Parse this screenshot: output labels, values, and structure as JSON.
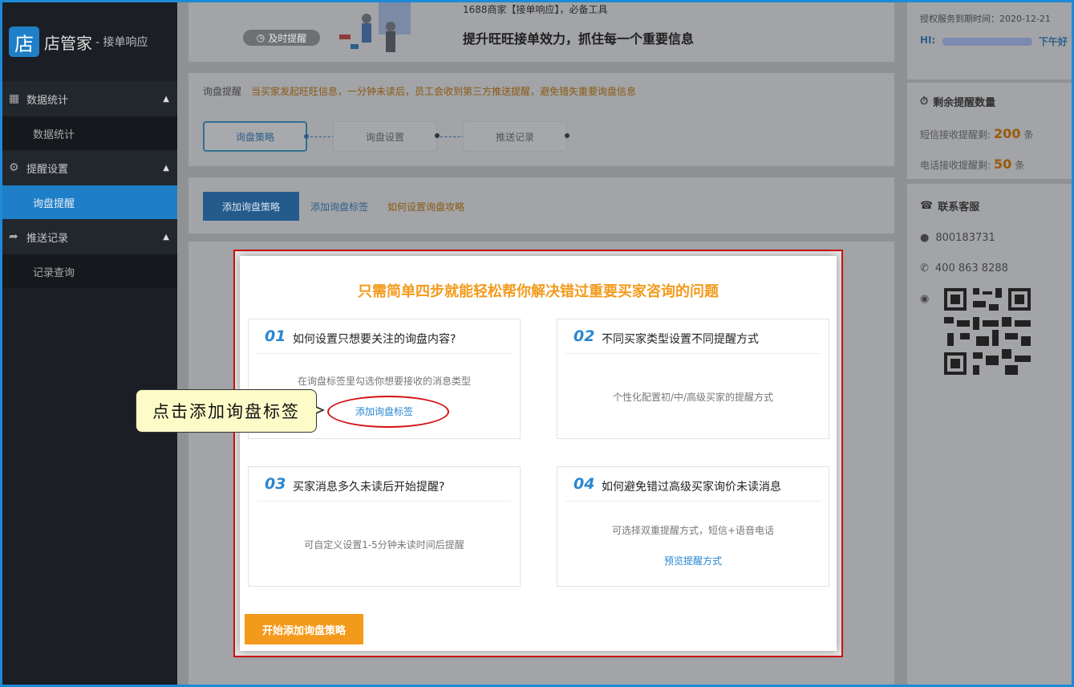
{
  "sidebar": {
    "logo_glyph": "店",
    "logo_text": "店管家",
    "logo_sub": "- 接单响应",
    "groups": [
      {
        "label": "数据统计",
        "icon": "bar-chart-icon",
        "items": [
          {
            "label": "数据统计",
            "active": false
          }
        ]
      },
      {
        "label": "提醒设置",
        "icon": "bell-gear-icon",
        "items": [
          {
            "label": "询盘提醒",
            "active": true
          }
        ]
      },
      {
        "label": "推送记录",
        "icon": "export-icon",
        "items": [
          {
            "label": "记录查询",
            "active": false
          }
        ]
      }
    ]
  },
  "banner": {
    "top_text": "1688商家【接单响应】，必备工具",
    "pill": "及时提醒",
    "title": "提升旺旺接单效力，抓住每一个重要信息"
  },
  "notice": {
    "label": "询盘提醒",
    "text": "当买家发起旺旺信息，一分钟未读后，员工会收到第三方推送提醒，避免错失重要询盘信息"
  },
  "steps": [
    "询盘策略",
    "询盘设置",
    "推送记录"
  ],
  "toolbar": {
    "add_button": "添加询盘策略",
    "link_tag": "添加询盘标签",
    "link_howto": "如何设置询盘攻略"
  },
  "right": {
    "expire": "授权服务到期时间：2020-12-21",
    "hi": "HI:",
    "hi_right": "下午好",
    "remaining_title": "剩余提醒数量",
    "sms_label": "短信接收提醒剩:",
    "sms_count": "200",
    "phone_label": "电话接收提醒剩:",
    "phone_count": "50",
    "unit": "条",
    "service_title": "联系客服",
    "qq": "800183731",
    "tel": "400 863 8288"
  },
  "modal": {
    "title": "只需简单四步就能轻松帮你解决错过重要买家咨询的问题",
    "cards": [
      {
        "num": "01",
        "title": "如何设置只想要关注的询盘内容?",
        "desc": "在询盘标签里勾选你想要接收的消息类型",
        "link": "添加询盘标签"
      },
      {
        "num": "02",
        "title": "不同买家类型设置不同提醒方式",
        "desc": "个性化配置初/中/高级买家的提醒方式",
        "link": ""
      },
      {
        "num": "03",
        "title": "买家消息多久未读后开始提醒?",
        "desc": "可自定义设置1-5分钟未读时间后提醒",
        "link": ""
      },
      {
        "num": "04",
        "title": "如何避免错过高级买家询价未读消息",
        "desc": "可选择双重提醒方式，短信+语音电话",
        "link": "预览提醒方式"
      }
    ],
    "start_button": "开始添加询盘策略"
  },
  "annotation": {
    "callout": "点击添加询盘标签"
  },
  "colors": {
    "accent_blue": "#1e7fc8",
    "accent_orange": "#f39a1c",
    "highlight_red": "#d21010",
    "callout_bg": "#fdfcc9"
  }
}
